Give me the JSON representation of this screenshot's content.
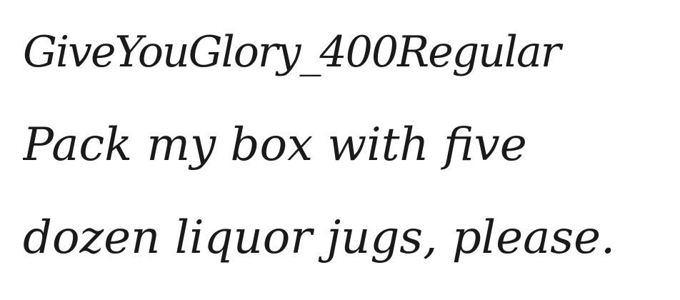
{
  "font_name": "GiveYouGlory_400Regular",
  "sample_lines": [
    "Pack my box with five",
    "dozen liquor jugs, please."
  ]
}
